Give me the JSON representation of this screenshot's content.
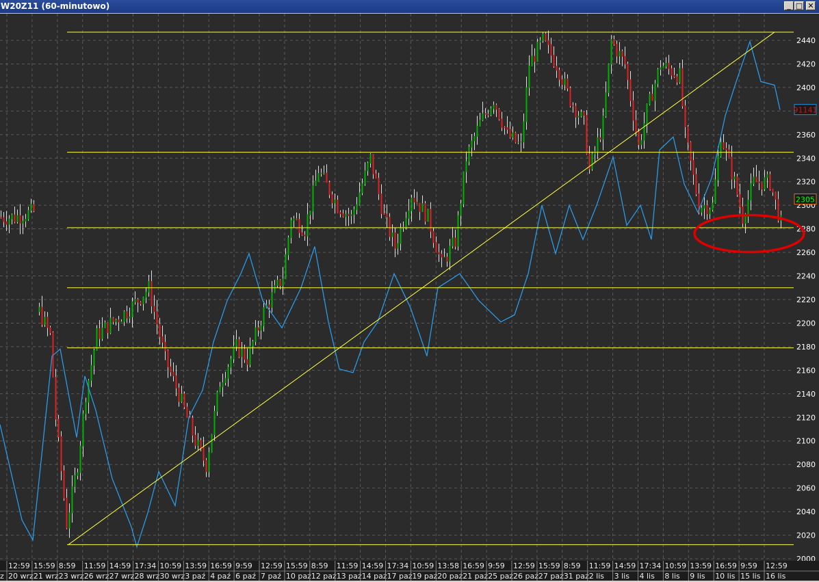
{
  "window": {
    "title": "W20Z11 (60-minutowo)",
    "buttons": [
      "minimize",
      "maximize",
      "close"
    ]
  },
  "chart_data": {
    "type": "candlestick-with-line",
    "title": "W20Z11 (60-minutowo)",
    "x_unit": "hourly bar index",
    "ylim": [
      2000,
      2440
    ],
    "y_ticks": [
      2000,
      2020,
      2040,
      2060,
      2080,
      2100,
      2120,
      2140,
      2160,
      2180,
      2200,
      2220,
      2240,
      2260,
      2280,
      2300,
      2320,
      2340,
      2360,
      2380,
      2400,
      2420,
      2440
    ],
    "grid": true,
    "time_labels": [
      "12:59",
      "15:59",
      "8:59",
      "11:59",
      "14:59",
      "17:34",
      "10:59",
      "13:59",
      "16:59",
      "9:59",
      "12:59",
      "15:59",
      "8:59",
      "11:59",
      "14:59",
      "17:34",
      "10:59",
      "13:58",
      "16:59",
      "9:59",
      "12:59",
      "15:59",
      "8:59",
      "11:59",
      "14:59",
      "17:34",
      "10:59",
      "13:59",
      "16:59",
      "9:59",
      "12:59"
    ],
    "date_labels": [
      "20 wrz",
      "21 wrz",
      "23 wrz",
      "26 wrz",
      "27 wrz",
      "28 wrz",
      "30 wrz",
      "3 paź",
      "4 paź",
      "6 paź",
      "7 paź",
      "10 paź",
      "12 paź",
      "13 paź",
      "14 paź",
      "17 paź",
      "19 paź",
      "20 paź",
      "21 paź",
      "25 paź",
      "26 paź",
      "27 paź",
      "31 paź",
      "2 lis",
      "3 lis",
      "4 lis",
      "8 lis",
      "9 lis",
      "10 lis",
      "15 lis",
      "16 lis"
    ],
    "first_partial_date": "z",
    "price_close": [
      [
        0,
        2290
      ],
      [
        5,
        2290
      ],
      [
        12,
        2295
      ],
      [
        14,
        2210
      ],
      [
        18,
        2190
      ],
      [
        20,
        2120
      ],
      [
        24,
        2030
      ],
      [
        28,
        2080
      ],
      [
        31,
        2140
      ],
      [
        35,
        2190
      ],
      [
        40,
        2200
      ],
      [
        46,
        2210
      ],
      [
        54,
        2230
      ],
      [
        60,
        2170
      ],
      [
        65,
        2140
      ],
      [
        71,
        2100
      ],
      [
        75,
        2080
      ],
      [
        80,
        2150
      ],
      [
        86,
        2180
      ],
      [
        90,
        2170
      ],
      [
        96,
        2210
      ],
      [
        103,
        2240
      ],
      [
        106,
        2290
      ],
      [
        111,
        2280
      ],
      [
        116,
        2330
      ],
      [
        123,
        2300
      ],
      [
        128,
        2290
      ],
      [
        135,
        2340
      ],
      [
        140,
        2290
      ],
      [
        144,
        2265
      ],
      [
        150,
        2310
      ],
      [
        156,
        2290
      ],
      [
        161,
        2250
      ],
      [
        166,
        2270
      ],
      [
        170,
        2340
      ],
      [
        175,
        2370
      ],
      [
        180,
        2390
      ],
      [
        185,
        2360
      ],
      [
        190,
        2350
      ],
      [
        193,
        2420
      ],
      [
        198,
        2440
      ],
      [
        203,
        2420
      ],
      [
        208,
        2390
      ],
      [
        213,
        2370
      ],
      [
        215,
        2330
      ],
      [
        220,
        2370
      ],
      [
        223,
        2440
      ],
      [
        228,
        2420
      ],
      [
        233,
        2350
      ],
      [
        236,
        2380
      ],
      [
        241,
        2420
      ],
      [
        248,
        2410
      ],
      [
        250,
        2360
      ],
      [
        255,
        2300
      ],
      [
        260,
        2300
      ],
      [
        263,
        2360
      ],
      [
        268,
        2320
      ],
      [
        271,
        2290
      ],
      [
        275,
        2320
      ],
      [
        281,
        2320
      ],
      [
        285,
        2285
      ]
    ],
    "indicator_line": [
      [
        0,
        2114
      ],
      [
        8,
        2033
      ],
      [
        12,
        2016
      ],
      [
        19,
        2172
      ],
      [
        22,
        2178
      ],
      [
        28,
        2103
      ],
      [
        31,
        2155
      ],
      [
        35,
        2126
      ],
      [
        41,
        2068
      ],
      [
        48,
        2027
      ],
      [
        50,
        2010
      ],
      [
        54,
        2039
      ],
      [
        58,
        2074
      ],
      [
        64,
        2045
      ],
      [
        69,
        2120
      ],
      [
        74,
        2143
      ],
      [
        78,
        2184
      ],
      [
        83,
        2219
      ],
      [
        88,
        2242
      ],
      [
        91,
        2259
      ],
      [
        96,
        2219
      ],
      [
        103,
        2196
      ],
      [
        110,
        2230
      ],
      [
        115,
        2265
      ],
      [
        120,
        2201
      ],
      [
        124,
        2161
      ],
      [
        129,
        2158
      ],
      [
        133,
        2184
      ],
      [
        138,
        2201
      ],
      [
        144,
        2242
      ],
      [
        150,
        2213
      ],
      [
        156,
        2172
      ],
      [
        160,
        2230
      ],
      [
        168,
        2242
      ],
      [
        175,
        2219
      ],
      [
        183,
        2201
      ],
      [
        188,
        2207
      ],
      [
        193,
        2242
      ],
      [
        198,
        2300
      ],
      [
        203,
        2259
      ],
      [
        208,
        2300
      ],
      [
        213,
        2271
      ],
      [
        218,
        2300
      ],
      [
        224,
        2341
      ],
      [
        229,
        2283
      ],
      [
        234,
        2300
      ],
      [
        238,
        2271
      ],
      [
        241,
        2347
      ],
      [
        246,
        2358
      ],
      [
        250,
        2318
      ],
      [
        255,
        2294
      ],
      [
        260,
        2323
      ],
      [
        265,
        2376
      ],
      [
        269,
        2405
      ],
      [
        274,
        2439
      ],
      [
        278,
        2405
      ],
      [
        283,
        2402
      ],
      [
        285,
        2381
      ]
    ],
    "horizontal_levels": [
      2447,
      2345,
      2281,
      2230,
      2179,
      2012
    ],
    "trend_line": [
      [
        25,
        2012
      ],
      [
        283,
        2447
      ]
    ],
    "annotation_ellipse": {
      "center": [
        274,
        2276
      ],
      "color": "#e00000"
    },
    "price_label": {
      "text": "2305",
      "color": "#00ff00",
      "border": "#e07020",
      "value": 2305
    },
    "indicator_label": {
      "text": "91141",
      "color": "#e01010",
      "border": "#2090e0",
      "value": 2381
    },
    "colors": {
      "background": "#2b2b2b",
      "up": "#00b000",
      "down": "#e02020",
      "wick": "#e0e0e0",
      "line": "#2a9ae8",
      "levels": "#ffff40"
    }
  }
}
